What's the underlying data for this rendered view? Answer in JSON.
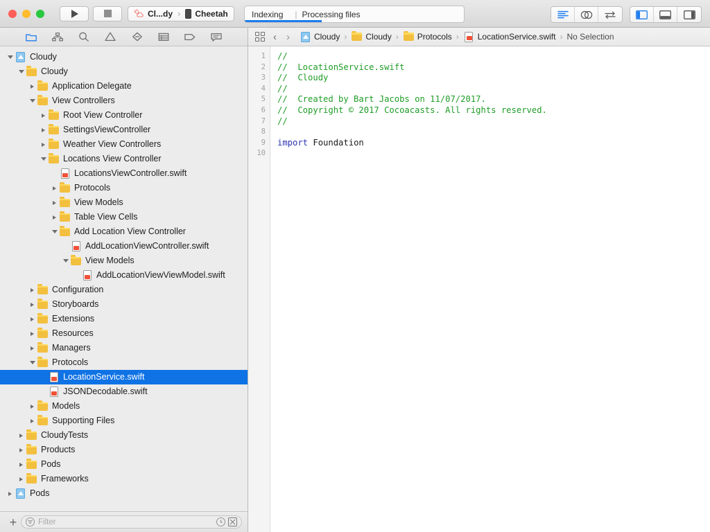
{
  "window": {
    "traffic_lights": [
      "close",
      "minimize",
      "zoom"
    ]
  },
  "toolbar": {
    "run_label": "Run",
    "stop_label": "Stop",
    "scheme": {
      "scheme_name": "Cl...dy",
      "separator": "›",
      "destination_name": "Cheetah",
      "scheme_icon": "cloud-sun-icon",
      "destination_icon": "iphone-icon"
    },
    "status": {
      "primary": "Indexing",
      "divider": "|",
      "secondary": "Processing files",
      "progress_percent": 35,
      "progress_color": "#1d7ced"
    },
    "editor_modes": [
      {
        "name": "standard-editor",
        "icon": "lines-icon",
        "active": true
      },
      {
        "name": "assistant-editor",
        "icon": "venn-icon",
        "active": false
      },
      {
        "name": "version-editor",
        "icon": "arrows-icon",
        "active": false
      }
    ],
    "panel_toggles": [
      {
        "name": "navigator-toggle",
        "icon": "left-panel-icon",
        "active": true
      },
      {
        "name": "debug-toggle",
        "icon": "bottom-panel-icon",
        "active": false
      },
      {
        "name": "utilities-toggle",
        "icon": "right-panel-icon",
        "active": false
      }
    ]
  },
  "navigator": {
    "tabs": [
      {
        "name": "project-navigator",
        "icon": "folder-icon",
        "active": true
      },
      {
        "name": "source-control-navigator",
        "icon": "hierarchy-icon",
        "active": false
      },
      {
        "name": "symbol-navigator",
        "icon": "search-icon",
        "active": false
      },
      {
        "name": "find-navigator",
        "icon": "warning-triangle-icon",
        "active": false
      },
      {
        "name": "issue-navigator",
        "icon": "issue-diamond-icon",
        "active": false
      },
      {
        "name": "test-navigator",
        "icon": "test-list-icon",
        "active": false
      },
      {
        "name": "debug-navigator",
        "icon": "tag-icon",
        "active": false
      },
      {
        "name": "report-navigator",
        "icon": "comment-icon",
        "active": false
      }
    ],
    "tree": [
      {
        "label": "Cloudy",
        "indent": 0,
        "icon": "project",
        "twisty": "open",
        "selected": false
      },
      {
        "label": "Cloudy",
        "indent": 1,
        "icon": "folder",
        "twisty": "open",
        "selected": false
      },
      {
        "label": "Application Delegate",
        "indent": 2,
        "icon": "folder",
        "twisty": "closed",
        "selected": false
      },
      {
        "label": "View Controllers",
        "indent": 2,
        "icon": "folder",
        "twisty": "open",
        "selected": false
      },
      {
        "label": "Root View Controller",
        "indent": 3,
        "icon": "folder",
        "twisty": "closed",
        "selected": false
      },
      {
        "label": "SettingsViewController",
        "indent": 3,
        "icon": "folder",
        "twisty": "closed",
        "selected": false
      },
      {
        "label": "Weather View Controllers",
        "indent": 3,
        "icon": "folder",
        "twisty": "closed",
        "selected": false
      },
      {
        "label": "Locations View Controller",
        "indent": 3,
        "icon": "folder",
        "twisty": "open",
        "selected": false
      },
      {
        "label": "LocationsViewController.swift",
        "indent": 4,
        "icon": "swift",
        "twisty": "none",
        "selected": false
      },
      {
        "label": "Protocols",
        "indent": 4,
        "icon": "folder",
        "twisty": "closed",
        "selected": false
      },
      {
        "label": "View Models",
        "indent": 4,
        "icon": "folder",
        "twisty": "closed",
        "selected": false
      },
      {
        "label": "Table View Cells",
        "indent": 4,
        "icon": "folder",
        "twisty": "closed",
        "selected": false
      },
      {
        "label": "Add Location View Controller",
        "indent": 4,
        "icon": "folder",
        "twisty": "open",
        "selected": false
      },
      {
        "label": "AddLocationViewController.swift",
        "indent": 5,
        "icon": "swift",
        "twisty": "none",
        "selected": false
      },
      {
        "label": "View Models",
        "indent": 5,
        "icon": "folder",
        "twisty": "open",
        "selected": false
      },
      {
        "label": "AddLocationViewViewModel.swift",
        "indent": 6,
        "icon": "swift",
        "twisty": "none",
        "selected": false
      },
      {
        "label": "Configuration",
        "indent": 2,
        "icon": "folder",
        "twisty": "closed",
        "selected": false
      },
      {
        "label": "Storyboards",
        "indent": 2,
        "icon": "folder",
        "twisty": "closed",
        "selected": false
      },
      {
        "label": "Extensions",
        "indent": 2,
        "icon": "folder",
        "twisty": "closed",
        "selected": false
      },
      {
        "label": "Resources",
        "indent": 2,
        "icon": "folder",
        "twisty": "closed",
        "selected": false
      },
      {
        "label": "Managers",
        "indent": 2,
        "icon": "folder",
        "twisty": "closed",
        "selected": false
      },
      {
        "label": "Protocols",
        "indent": 2,
        "icon": "folder",
        "twisty": "open",
        "selected": false
      },
      {
        "label": "LocationService.swift",
        "indent": 3,
        "icon": "swift",
        "twisty": "none",
        "selected": true
      },
      {
        "label": "JSONDecodable.swift",
        "indent": 3,
        "icon": "swift",
        "twisty": "none",
        "selected": false
      },
      {
        "label": "Models",
        "indent": 2,
        "icon": "folder",
        "twisty": "closed",
        "selected": false
      },
      {
        "label": "Supporting Files",
        "indent": 2,
        "icon": "folder",
        "twisty": "closed",
        "selected": false
      },
      {
        "label": "CloudyTests",
        "indent": 1,
        "icon": "folder",
        "twisty": "closed",
        "selected": false
      },
      {
        "label": "Products",
        "indent": 1,
        "icon": "folder",
        "twisty": "closed",
        "selected": false
      },
      {
        "label": "Pods",
        "indent": 1,
        "icon": "folder",
        "twisty": "closed",
        "selected": false
      },
      {
        "label": "Frameworks",
        "indent": 1,
        "icon": "folder",
        "twisty": "closed",
        "selected": false
      },
      {
        "label": "Pods",
        "indent": 0,
        "icon": "project",
        "twisty": "closed",
        "selected": false
      }
    ],
    "selection_color": "#0f72e5",
    "filter": {
      "add_label": "+",
      "placeholder": "Filter",
      "value": "",
      "recent_icon": "clock-icon",
      "scm_icon": "source-control-filter-icon"
    }
  },
  "editor": {
    "jumpbar": {
      "related_items_icon": "related-items-icon",
      "back_label": "‹",
      "forward_label": "›",
      "breadcrumbs": [
        {
          "label": "Cloudy",
          "icon": "project"
        },
        {
          "label": "Cloudy",
          "icon": "folder"
        },
        {
          "label": "Protocols",
          "icon": "folder"
        },
        {
          "label": "LocationService.swift",
          "icon": "swift"
        },
        {
          "label": "No Selection",
          "icon": "none"
        }
      ],
      "separator": "›"
    },
    "code": {
      "line_numbers": [
        1,
        2,
        3,
        4,
        5,
        6,
        7,
        8,
        9,
        10
      ],
      "lines": [
        {
          "n": 1,
          "segments": [
            {
              "t": "//",
              "c": "cm"
            }
          ]
        },
        {
          "n": 2,
          "segments": [
            {
              "t": "//  LocationService.swift",
              "c": "cm"
            }
          ]
        },
        {
          "n": 3,
          "segments": [
            {
              "t": "//  Cloudy",
              "c": "cm"
            }
          ]
        },
        {
          "n": 4,
          "segments": [
            {
              "t": "//",
              "c": "cm"
            }
          ]
        },
        {
          "n": 5,
          "segments": [
            {
              "t": "//  Created by Bart Jacobs on 11/07/2017.",
              "c": "cm"
            }
          ]
        },
        {
          "n": 6,
          "segments": [
            {
              "t": "//  Copyright © 2017 Cocoacasts. All rights reserved.",
              "c": "cm"
            }
          ]
        },
        {
          "n": 7,
          "segments": [
            {
              "t": "//",
              "c": "cm"
            }
          ]
        },
        {
          "n": 8,
          "segments": [
            {
              "t": "",
              "c": "pl"
            }
          ]
        },
        {
          "n": 9,
          "segments": [
            {
              "t": "import",
              "c": "kw"
            },
            {
              "t": " Foundation",
              "c": "pl"
            }
          ]
        },
        {
          "n": 10,
          "segments": [
            {
              "t": "",
              "c": "pl"
            }
          ]
        }
      ],
      "comment_color": "#1e9c26",
      "keyword_color": "#2c33b0",
      "text_color": "#1a1a1a"
    }
  }
}
